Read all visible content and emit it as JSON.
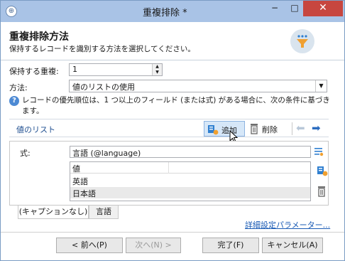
{
  "window": {
    "title": "重複排除 *",
    "buttons": {
      "minimize": "−",
      "maximize": "□",
      "close": "✕"
    }
  },
  "header": {
    "title": "重複排除方法",
    "subtitle": "保持するレコードを識別する方法を選択してください。",
    "icon": "funnel-icon"
  },
  "form": {
    "keep_label": "保持する重複:",
    "keep_value": "1",
    "method_label": "方法:",
    "method_value": "値のリストの使用"
  },
  "info": {
    "text": "レコードの優先順位は、1 つ以上のフィールド (または式) がある場合に、次の条件に基づきます。"
  },
  "values_list": {
    "title": "値のリスト",
    "add_label": "追加",
    "delete_label": "削除",
    "formula_label": "式:",
    "formula_value": "言語 (@language)",
    "grid_header": "値",
    "rows": [
      "英語",
      "日本語"
    ]
  },
  "tabs": [
    {
      "label": "(キャプションなし)",
      "active": true
    },
    {
      "label": "言語",
      "active": false
    }
  ],
  "advanced_link": "詳細設定パラメーター...",
  "footer": {
    "prev": "< 前へ(P)",
    "next": "次へ(N) >",
    "finish": "完了(F)",
    "cancel": "キャンセル(A)"
  },
  "colors": {
    "titlebar": "#a9c3e6",
    "close": "#c7463f",
    "accent": "#1f4f90",
    "link": "#1a5bb5"
  }
}
